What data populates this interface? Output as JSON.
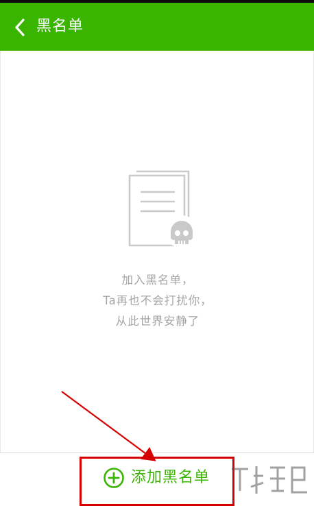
{
  "header": {
    "title": "黑名单",
    "background": "#39b500"
  },
  "empty_state": {
    "lines": [
      "加入黑名单，",
      "Ta再也不会打扰你，",
      "从此世界安静了"
    ],
    "text_color": "#a6a6a6"
  },
  "footer": {
    "add_label": "添加黑名单",
    "accent": "#39b500"
  },
  "annotation": {
    "color": "#d60000"
  },
  "icons": {
    "back": "chevron-left-icon",
    "illustration": "document-skull-icon",
    "add": "plus-circle-icon"
  }
}
